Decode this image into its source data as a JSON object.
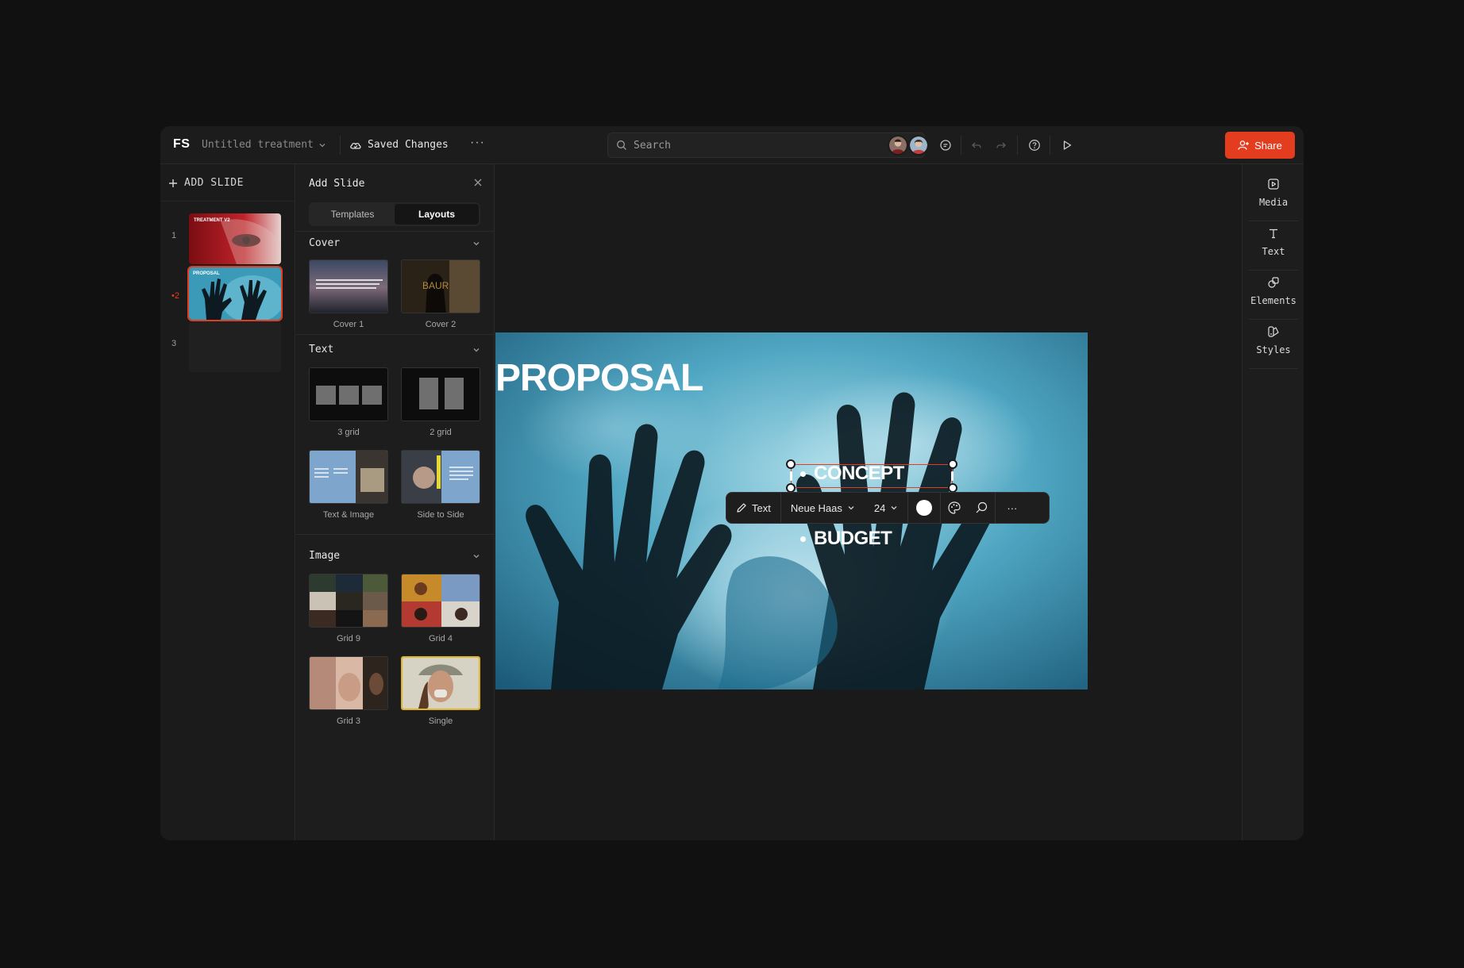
{
  "topbar": {
    "logo": "FS",
    "doc_title": "Untitled treatment",
    "saved_status": "Saved Changes",
    "more": "···",
    "search_placeholder": "Search",
    "share_label": "Share"
  },
  "slides": {
    "add_label": "ADD SLIDE",
    "items": [
      {
        "number": "1",
        "thumb_text": "TREATMENT V2"
      },
      {
        "number": "•2",
        "thumb_text": "PROPOSAL"
      },
      {
        "number": "3",
        "thumb_text": ""
      }
    ]
  },
  "panel": {
    "title": "Add Slide",
    "tabs": [
      "Templates",
      "Layouts"
    ],
    "active_tab": "Layouts",
    "sections": [
      {
        "name": "Cover",
        "tiles": [
          "Cover 1",
          "Cover 2"
        ]
      },
      {
        "name": "Text",
        "tiles": [
          "3 grid",
          "2 grid",
          "Text & Image",
          "Side to Side"
        ]
      },
      {
        "name": "Image",
        "tiles": [
          "Grid 9",
          "Grid 4",
          "Grid 3",
          "Single"
        ]
      }
    ]
  },
  "canvas": {
    "title": "PROPOSAL",
    "bullets": [
      "CONCEPT",
      "BUDGET"
    ]
  },
  "format_bar": {
    "text_label": "Text",
    "font": "Neue Haas",
    "size": "24",
    "more": "···"
  },
  "tools": [
    "Media",
    "Text",
    "Elements",
    "Styles"
  ],
  "colors": {
    "accent": "#e43c1e",
    "background": "#111111",
    "panel": "#1d1d1d"
  }
}
